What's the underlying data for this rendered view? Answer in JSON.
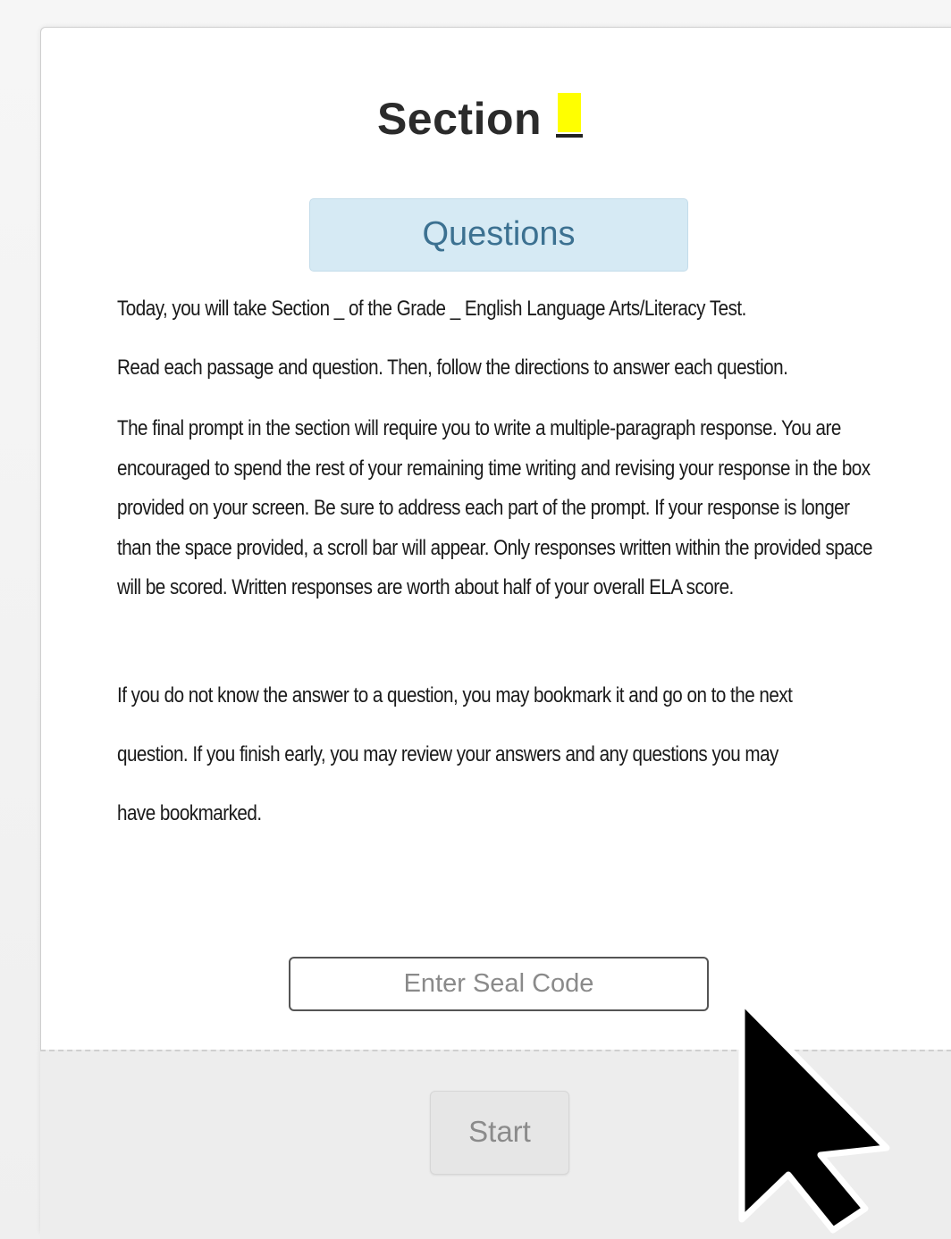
{
  "section": {
    "title": "Section",
    "blank": "_"
  },
  "header": {
    "questions_label": "Questions"
  },
  "instructions": {
    "p1": "Today, you will take Section _ of the Grade _ English Language Arts/Literacy Test.",
    "p2": "Read each passage and question. Then, follow the directions to answer each question.",
    "p3": "The final prompt in the section will require you to write a multiple-paragraph response. You are encouraged to spend the rest of your remaining time writing and revising your response in the box provided on your screen. Be sure to address each part of the prompt. If your response is longer than the space provided, a scroll bar will appear. Only responses written within the provided space will be scored. Written responses are worth about half of your overall ELA score.",
    "p4": "If you do not know the answer to a question, you may bookmark it and go on to the next question. If you finish early, you may review your answers and any questions you may have bookmarked."
  },
  "seal_code": {
    "value": "",
    "placeholder": "Enter Seal Code"
  },
  "footer": {
    "start_label": "Start"
  },
  "colors": {
    "highlight": "#ffff00",
    "badge_bg": "#d6eaf4",
    "badge_text": "#3c7191",
    "start_bg": "#e6e6e6"
  },
  "icons": {
    "cursor": "mouse-pointer-icon"
  }
}
